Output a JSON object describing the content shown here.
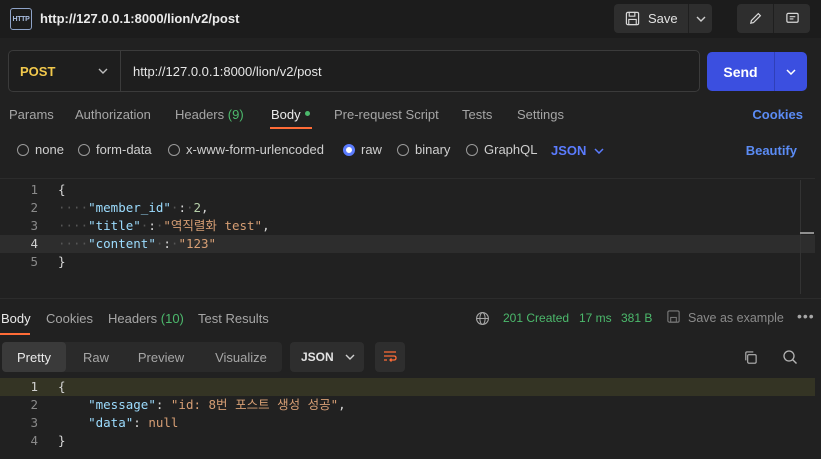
{
  "tab": {
    "title": "http://127.0.0.1:8000/lion/v2/post",
    "icon": "HTTP"
  },
  "toolbar": {
    "save_label": "Save"
  },
  "request": {
    "method": "POST",
    "url": "http://127.0.0.1:8000/lion/v2/post",
    "send_label": "Send"
  },
  "request_tabs": [
    {
      "label": "Params"
    },
    {
      "label": "Authorization"
    },
    {
      "label": "Headers",
      "count": "(9)"
    },
    {
      "label": "Body"
    },
    {
      "label": "Pre-request Script"
    },
    {
      "label": "Tests"
    },
    {
      "label": "Settings"
    }
  ],
  "cookies_label": "Cookies",
  "body_types": [
    "none",
    "form-data",
    "x-www-form-urlencoded",
    "raw",
    "binary",
    "GraphQL"
  ],
  "selected_body_type": "raw",
  "body_format": "JSON",
  "beautify_label": "Beautify",
  "request_body": {
    "line_numbers": [
      "1",
      "2",
      "3",
      "4",
      "5"
    ],
    "lines": {
      "open": "{",
      "k1": "\"member_id\"",
      "v1": "2",
      "k2": "\"title\"",
      "v2": "\"역직렬화 test\"",
      "k3": "\"content\"",
      "v3": "\"123\"",
      "close": "}"
    }
  },
  "response_tabs": [
    {
      "label": "Body"
    },
    {
      "label": "Cookies"
    },
    {
      "label": "Headers",
      "count": "(10)"
    },
    {
      "label": "Test Results"
    }
  ],
  "response_status": {
    "status": "201 Created",
    "time": "17 ms",
    "size": "381 B",
    "save_example": "Save as example"
  },
  "response_views": [
    "Pretty",
    "Raw",
    "Preview",
    "Visualize"
  ],
  "response_format": "JSON",
  "response_body": {
    "line_numbers": [
      "1",
      "2",
      "3",
      "4"
    ],
    "lines": {
      "open": "{",
      "k1": "\"message\"",
      "v1": "\"id: 8번 포스트 생성 성공\"",
      "k2": "\"data\"",
      "v2": "null",
      "close": "}"
    }
  },
  "colors": {
    "accent": "#ff6c37",
    "send": "#3b4fe0",
    "method": "#f2c94c",
    "status_ok": "#4cb96c"
  }
}
